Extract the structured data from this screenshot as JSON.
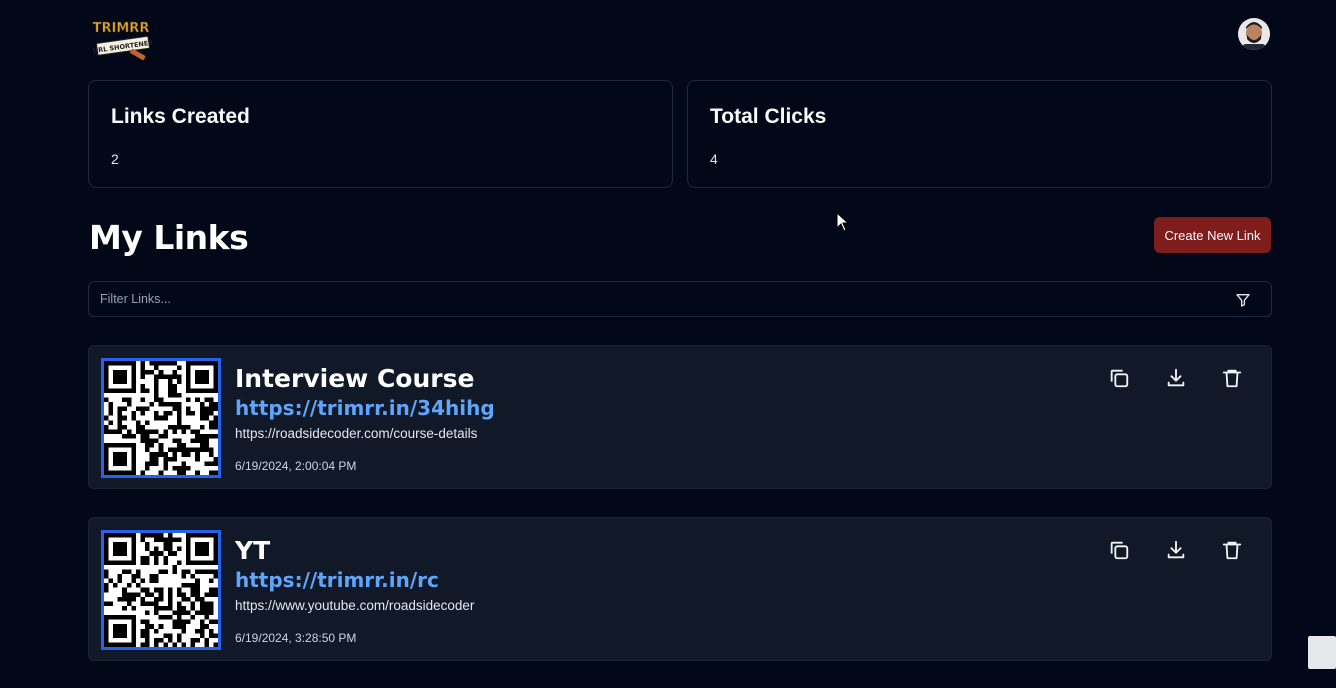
{
  "header": {
    "logo_text": "TRIMRR",
    "logo_tagline": "URL SHORTENER"
  },
  "stats": {
    "links_created_label": "Links Created",
    "links_created_value": "2",
    "total_clicks_label": "Total Clicks",
    "total_clicks_value": "4"
  },
  "main": {
    "title": "My Links",
    "create_button": "Create New Link",
    "filter_placeholder": "Filter Links..."
  },
  "links": [
    {
      "title": "Interview Course",
      "short_url": "https://trimrr.in/34hihg",
      "original_url": "https://roadsidecoder.com/course-details",
      "created_at": "6/19/2024, 2:00:04 PM"
    },
    {
      "title": "YT",
      "short_url": "https://trimrr.in/rc",
      "original_url": "https://www.youtube.com/roadsidecoder",
      "created_at": "6/19/2024, 3:28:50 PM"
    }
  ],
  "colors": {
    "background": "#020817",
    "card": "#111827",
    "accent_button": "#7f1d1d",
    "link_blue": "#60a5fa",
    "qr_border": "#2563eb"
  },
  "icons": {
    "copy": "copy-icon",
    "download": "download-icon",
    "delete": "trash-icon",
    "filter": "filter-icon"
  }
}
